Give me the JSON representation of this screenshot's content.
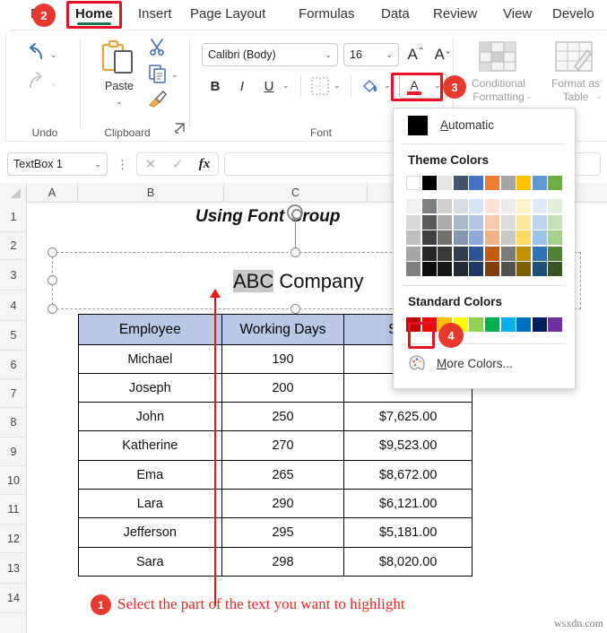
{
  "ribbon": {
    "tabs": [
      {
        "label": "File",
        "active": false
      },
      {
        "label": "Home",
        "active": true
      },
      {
        "label": "Insert",
        "active": false
      },
      {
        "label": "Page Layout",
        "active": false
      },
      {
        "label": "Formulas",
        "active": false
      },
      {
        "label": "Data",
        "active": false
      },
      {
        "label": "Review",
        "active": false
      },
      {
        "label": "View",
        "active": false
      },
      {
        "label": "Develo",
        "active": false
      }
    ],
    "groups": {
      "undo": {
        "label": "Undo",
        "undo_icon": "undo-arrow-icon",
        "redo_icon": "redo-arrow-icon"
      },
      "clipboard": {
        "label": "Clipboard",
        "paste_label": "Paste",
        "paste_icon": "paste-clipboard-icon",
        "cut_icon": "scissors-icon",
        "copy_icon": "copy-pages-icon",
        "format_painter_icon": "paintbrush-icon",
        "launcher_icon": "dialog-launcher-icon"
      },
      "font": {
        "label": "Font",
        "font_name": "Calibri (Body)",
        "font_size": "16",
        "grow_font_icon": "increase-font-size-icon",
        "shrink_font_icon": "decrease-font-size-icon",
        "bold_label": "B",
        "italic_label": "I",
        "underline_label": "U",
        "borders_icon": "borders-icon",
        "fill_color_icon": "fill-color-icon",
        "font_color_icon": "font-color-icon"
      },
      "styles": {
        "conditional_formatting_label": "Conditional\nFormatting",
        "conditional_formatting_icon": "conditional-formatting-icon",
        "format_as_table_label": "Format as\nTable",
        "format_as_table_icon": "format-as-table-icon"
      }
    }
  },
  "formula_bar": {
    "name_box_value": "TextBox 1",
    "cancel_icon": "cancel-x-icon",
    "enter_icon": "enter-check-icon",
    "fx_label": "fx",
    "formula_value": ""
  },
  "grid": {
    "columns": [
      "A",
      "B",
      "C"
    ],
    "rows": [
      "1",
      "2",
      "3",
      "4",
      "5",
      "6",
      "7",
      "8",
      "9",
      "10",
      "11",
      "12",
      "13",
      "14"
    ],
    "worksheet_title": "Using Font Group",
    "textbox": {
      "selected_text": "ABC",
      "rest_text": " Company"
    }
  },
  "table": {
    "headers": [
      "Employee",
      "Working Days",
      "Salary"
    ],
    "header_fill": "#b9c8e4",
    "rows": [
      {
        "employee": "Michael",
        "days": "190",
        "salary": ""
      },
      {
        "employee": "Joseph",
        "days": "200",
        "salary": ""
      },
      {
        "employee": "John",
        "days": "250",
        "salary": "$7,625.00"
      },
      {
        "employee": "Katherine",
        "days": "270",
        "salary": "$9,523.00"
      },
      {
        "employee": "Ema",
        "days": "265",
        "salary": "$8,672.00"
      },
      {
        "employee": "Lara",
        "days": "290",
        "salary": "$6,121.00"
      },
      {
        "employee": "Jefferson",
        "days": "295",
        "salary": "$5,181.00"
      },
      {
        "employee": "Sara",
        "days": "298",
        "salary": "$8,020.00"
      }
    ]
  },
  "annotations": {
    "step1_badge": "1",
    "step2_badge": "2",
    "step3_badge": "3",
    "step4_badge": "4",
    "caption": "Select the part of the text you want to highlight",
    "caption_color": "#ea2a23",
    "highlight_box_color": "#e81123"
  },
  "color_panel": {
    "automatic_label": "Automatic",
    "automatic_swatch": "#000000",
    "theme_colors_label": "Theme Colors",
    "standard_colors_label": "Standard Colors",
    "more_colors_label": "More Colors...",
    "more_colors_icon": "color-palette-icon",
    "theme_base": [
      "#ffffff",
      "#000000",
      "#e7e6e6",
      "#44546a",
      "#4472c4",
      "#ed7d31",
      "#a5a5a5",
      "#ffc000",
      "#5b9bd5",
      "#70ad47"
    ],
    "theme_variants": [
      [
        "#f2f2f2",
        "#d9d9d9",
        "#bfbfbf",
        "#a6a6a6",
        "#808080"
      ],
      [
        "#7f7f7f",
        "#595959",
        "#404040",
        "#262626",
        "#0d0d0d"
      ],
      [
        "#d0cece",
        "#aeaaaa",
        "#757070",
        "#3b3838",
        "#161616"
      ],
      [
        "#d6dce4",
        "#acb9ca",
        "#8496b0",
        "#333f4f",
        "#222a35"
      ],
      [
        "#d9e2f3",
        "#b4c6e7",
        "#8eaadb",
        "#2e5496",
        "#1f3864"
      ],
      [
        "#fbe4d5",
        "#f7caac",
        "#f4b183",
        "#c55a11",
        "#833c0b"
      ],
      [
        "#ededed",
        "#dbdbdb",
        "#c9c9c9",
        "#7b7b7b",
        "#525252"
      ],
      [
        "#fff2cc",
        "#ffe598",
        "#ffd965",
        "#bf9000",
        "#7f6000"
      ],
      [
        "#deeaf6",
        "#bdd6ee",
        "#9cc3e5",
        "#2e74b5",
        "#1f4e79"
      ],
      [
        "#e2efd9",
        "#c5e0b3",
        "#a8d08d",
        "#538135",
        "#375623"
      ]
    ],
    "standard_colors": [
      "#c00000",
      "#ff0000",
      "#ffc000",
      "#ffff00",
      "#92d050",
      "#00b050",
      "#00b0f0",
      "#0070c0",
      "#002060",
      "#7030a0"
    ],
    "selected_standard_index": 1
  },
  "watermark": "wsxdn.com"
}
